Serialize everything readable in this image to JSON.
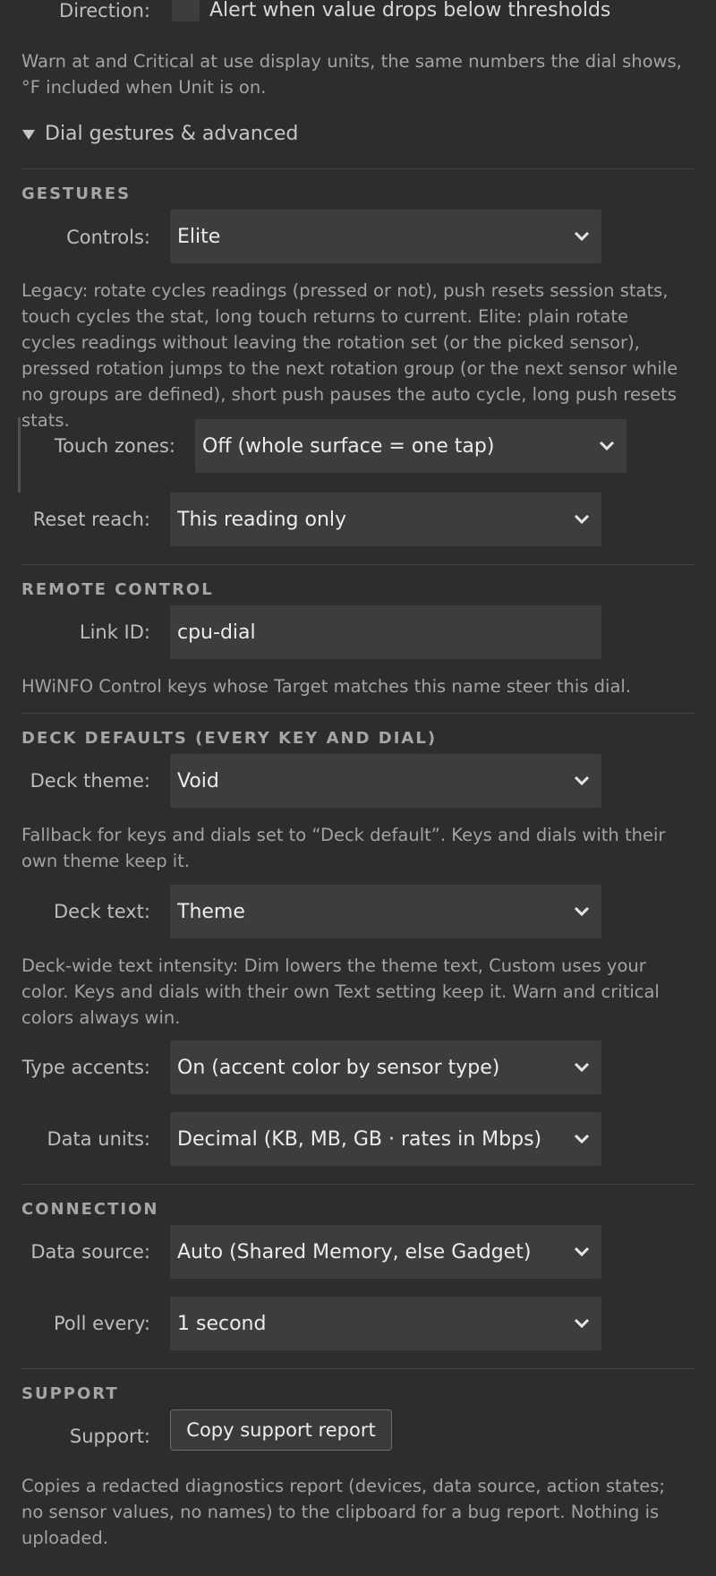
{
  "direction": {
    "label": "Direction:",
    "checkbox_label": "Alert when value drops below thresholds"
  },
  "threshold_help": "Warn at and Critical at use display units, the same numbers the dial shows, °F included when Unit is on.",
  "advanced_toggle": "Dial gestures & advanced",
  "gestures": {
    "heading": "GESTURES",
    "controls_label": "Controls:",
    "controls_value": "Elite",
    "controls_help": "Legacy: rotate cycles readings (pressed or not), push resets session stats, touch cycles the stat, long touch returns to current. Elite: plain rotate cycles readings without leaving the rotation set (or the picked sensor), pressed rotation jumps to the next rotation group (or the next sensor while no groups are defined), short push pauses the auto cycle, long push resets stats.",
    "touch_zones_label": "Touch zones:",
    "touch_zones_value": "Off (whole surface = one tap)",
    "reset_reach_label": "Reset reach:",
    "reset_reach_value": "This reading only"
  },
  "remote": {
    "heading": "REMOTE CONTROL",
    "link_id_label": "Link ID:",
    "link_id_value": "cpu-dial",
    "help": "HWiNFO Control keys whose Target matches this name steer this dial."
  },
  "deck": {
    "heading": "DECK DEFAULTS (EVERY KEY AND DIAL)",
    "theme_label": "Deck theme:",
    "theme_value": "Void",
    "theme_help": "Fallback for keys and dials set to “Deck default”. Keys and dials with their own theme keep it.",
    "text_label": "Deck text:",
    "text_value": "Theme",
    "text_help": "Deck-wide text intensity: Dim lowers the theme text, Custom uses your color. Keys and dials with their own Text setting keep it. Warn and critical colors always win.",
    "accents_label": "Type accents:",
    "accents_value": "On (accent color by sensor type)",
    "units_label": "Data units:",
    "units_value": "Decimal (KB, MB, GB · rates in Mbps)"
  },
  "connection": {
    "heading": "CONNECTION",
    "source_label": "Data source:",
    "source_value": "Auto (Shared Memory, else Gadget)",
    "poll_label": "Poll every:",
    "poll_value": "1 second"
  },
  "support": {
    "heading": "SUPPORT",
    "label": "Support:",
    "button": "Copy support report",
    "help": "Copies a redacted diagnostics report (devices, data source, action states; no sensor values, no names) to the clipboard for a bug report. Nothing is uploaded."
  },
  "colors": {
    "background": "#2d2d2d",
    "control": "#3d3d3d",
    "help_text": "#a3a3a3"
  }
}
